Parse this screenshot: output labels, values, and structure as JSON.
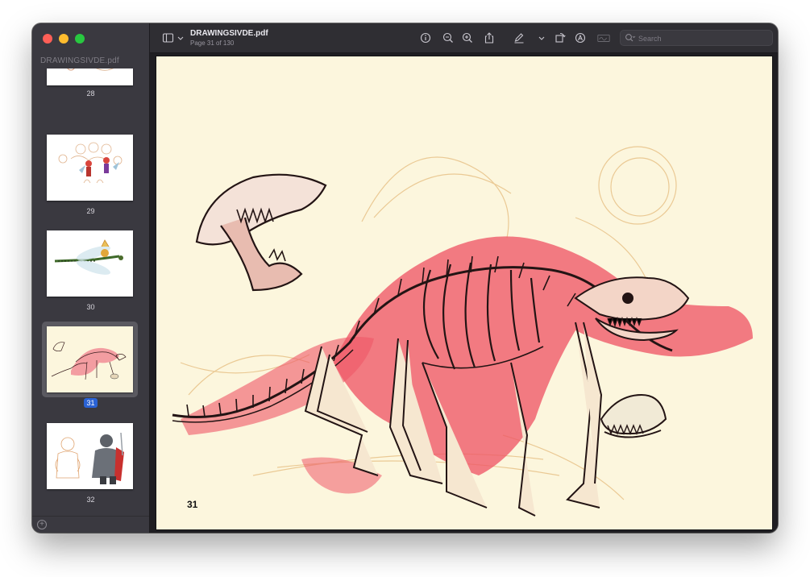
{
  "sidebar": {
    "title": "DRAWINGSIVDE.pdf",
    "thumbnails": [
      {
        "page": "28"
      },
      {
        "page": "29"
      },
      {
        "page": "30"
      },
      {
        "page": "31"
      },
      {
        "page": "32"
      }
    ],
    "selected_page": "31"
  },
  "toolbar": {
    "title": "DRAWINGSIVDE.pdf",
    "subtitle": "Page 31 of 130",
    "icons": [
      "sidebar-icon",
      "chevron-down-icon",
      "info-icon",
      "zoom-out-icon",
      "zoom-in-icon",
      "share-icon",
      "markup-pen-icon",
      "chevron-down-icon",
      "rotate-icon",
      "markup-circle-icon",
      "signature-icon",
      "search-icon"
    ],
    "search_placeholder": "Search"
  },
  "document": {
    "page_number_label": "31"
  },
  "colors": {
    "accent": "#2a62d4",
    "page_background": "#fcf6dd",
    "sketch_red": "#e8455a"
  }
}
